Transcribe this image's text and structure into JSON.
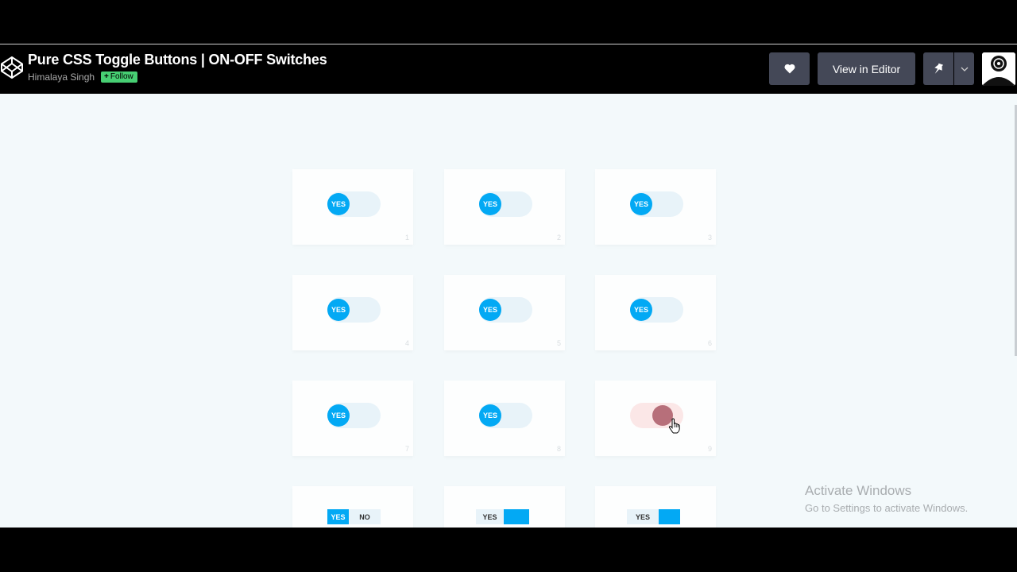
{
  "header": {
    "title": "Pure CSS Toggle Buttons | ON-OFF Switches",
    "author": "Himalaya Singh",
    "follow_label": "Follow",
    "view_in_editor_label": "View in Editor"
  },
  "icons": {
    "logo": "codepen-logo-icon",
    "heart": "heart-icon",
    "pin": "pin-icon",
    "caret": "chevron-down-icon",
    "avatar": "user-avatar"
  },
  "toggles": [
    {
      "label": "YES",
      "number": "1",
      "state": "on"
    },
    {
      "label": "YES",
      "number": "2",
      "state": "on"
    },
    {
      "label": "YES",
      "number": "3",
      "state": "on"
    },
    {
      "label": "YES",
      "number": "4",
      "state": "on"
    },
    {
      "label": "YES",
      "number": "5",
      "state": "on"
    },
    {
      "label": "YES",
      "number": "6",
      "state": "on"
    },
    {
      "label": "YES",
      "number": "7",
      "state": "on"
    },
    {
      "label": "YES",
      "number": "8",
      "state": "on"
    },
    {
      "label": "",
      "number": "9",
      "state": "off"
    }
  ],
  "square_toggles": [
    {
      "yes_label": "YES",
      "no_label": "NO"
    },
    {
      "yes_label": "YES"
    },
    {
      "yes_label": "YES"
    }
  ],
  "colors": {
    "accent": "#03a9f4",
    "follow_green": "#47cf73",
    "button_bg": "#444857",
    "stage_bg": "#f3f9fb",
    "off_knob": "#b76f7a"
  },
  "watermark": {
    "line1": "Activate Windows",
    "line2": "Go to Settings to activate Windows."
  }
}
